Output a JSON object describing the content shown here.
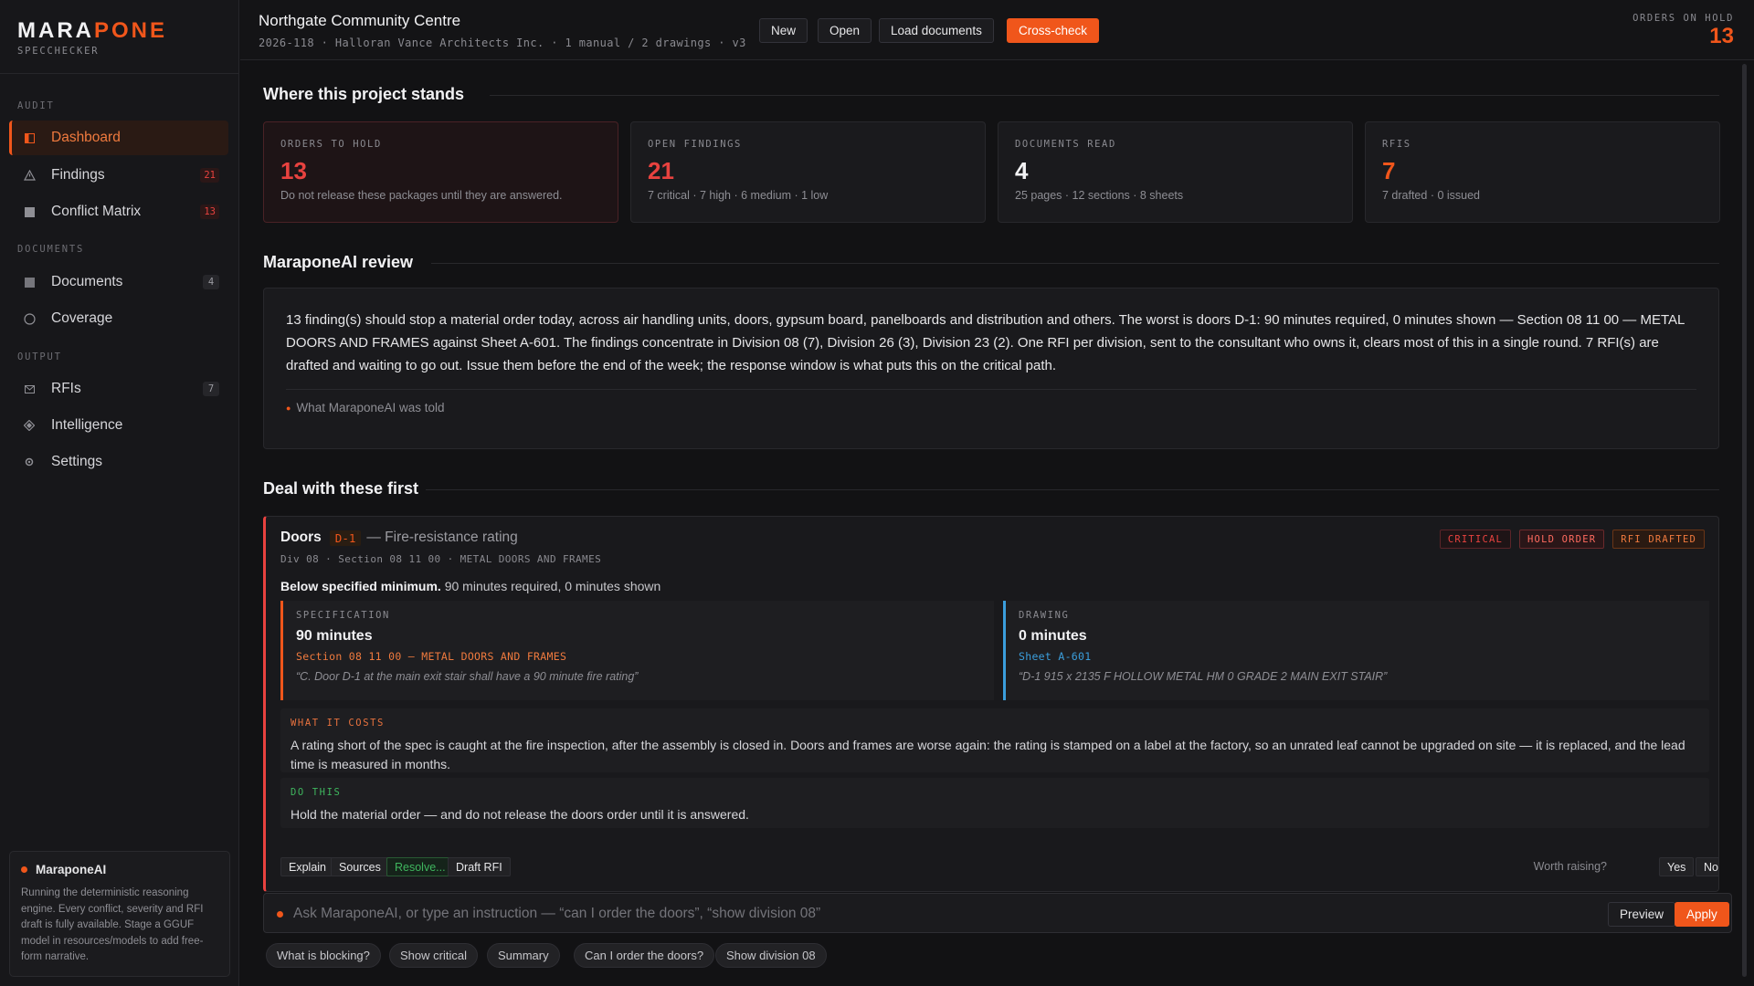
{
  "brand": {
    "name_a": "MARA",
    "name_b": "PONE",
    "subtitle": "SPECCHECKER"
  },
  "sidebar": {
    "sections": {
      "audit": "AUDIT",
      "documents": "DOCUMENTS",
      "output": "OUTPUT"
    },
    "items": [
      {
        "label": "Dashboard",
        "icon": "dashboard-icon"
      },
      {
        "label": "Findings",
        "badge": "21",
        "icon": "warning-icon"
      },
      {
        "label": "Conflict Matrix",
        "badge": "13",
        "icon": "matrix-icon"
      },
      {
        "label": "Documents",
        "badge": "4",
        "icon": "document-icon"
      },
      {
        "label": "Coverage",
        "icon": "coverage-icon"
      },
      {
        "label": "RFIs",
        "badge": "7",
        "icon": "mail-icon"
      },
      {
        "label": "Intelligence",
        "icon": "diamond-icon"
      },
      {
        "label": "Settings",
        "icon": "gear-icon"
      }
    ],
    "ai_box": {
      "title": "MaraponeAI",
      "desc": "Running the deterministic reasoning engine. Every conflict, severity and RFI draft is fully available. Stage a GGUF model in resources/models to add free-form narrative."
    }
  },
  "topbar": {
    "title": "Northgate Community Centre",
    "meta": "2026-118 · Halloran Vance Architects Inc. · 1 manual / 2 drawings · v3",
    "buttons": {
      "new": "New",
      "open": "Open",
      "load": "Load documents",
      "cross": "Cross-check"
    },
    "hold_label": "ORDERS ON HOLD",
    "hold_value": "13"
  },
  "stands": {
    "heading": "Where this project stands",
    "stats": [
      {
        "label": "ORDERS TO HOLD",
        "value": "13",
        "sub": "Do not release these packages until they are answered."
      },
      {
        "label": "OPEN FINDINGS",
        "value": "21",
        "sub": "7 critical · 7 high · 6 medium · 1 low"
      },
      {
        "label": "DOCUMENTS READ",
        "value": "4",
        "sub": "25 pages · 12 sections · 8 sheets"
      },
      {
        "label": "RFIS",
        "value": "7",
        "sub": "7 drafted · 0 issued"
      }
    ]
  },
  "review": {
    "heading": "MaraponeAI review",
    "text": "13 finding(s) should stop a material order today, across air handling units, doors, gypsum board, panelboards and distribution and others. The worst is doors D-1: 90 minutes required, 0 minutes shown — Section 08 11 00 — METAL DOORS AND FRAMES against Sheet A-601. The findings concentrate in Division 08 (7), Division 26 (3), Division 23 (2). One RFI per division, sent to the consultant who owns it, clears most of this in a single round. 7 RFI(s) are drafted and waiting to go out. Issue them before the end of the week; the response window is what puts this on the critical path.",
    "told": "What MaraponeAI was told"
  },
  "first": {
    "heading": "Deal with these first",
    "finding": {
      "name": "Doors",
      "tag": "D-1",
      "title": "— Fire-resistance rating",
      "sub": "Div 08 · Section 08 11 00 · METAL DOORS AND FRAMES",
      "badges": {
        "critical": "CRITICAL",
        "hold": "HOLD ORDER",
        "rfi": "RFI DRAFTED"
      },
      "summary_bold": "Below specified minimum.",
      "summary_rest": " 90 minutes required, 0 minutes shown",
      "spec": {
        "label": "SPECIFICATION",
        "value": "90 minutes",
        "ref": "Section 08 11 00 — METAL DOORS AND FRAMES",
        "quote": "“C. Door D-1 at the main exit stair shall have a 90 minute fire rating”"
      },
      "drawing": {
        "label": "DRAWING",
        "value": "0 minutes",
        "ref": "Sheet A-601",
        "quote": "“D-1 915 x 2135 F HOLLOW METAL HM 0 GRADE 2 MAIN EXIT STAIR”"
      },
      "cost": {
        "label": "WHAT IT COSTS",
        "text": "A rating short of the spec is caught at the fire inspection, after the assembly is closed in. Doors and frames are worse again: the rating is stamped on a label at the factory, so an unrated leaf cannot be upgraded on site — it is replaced, and the lead time is measured in months."
      },
      "do": {
        "label": "DO THIS",
        "text": "Hold the material order — and do not release the doors order until it is answered."
      },
      "actions": {
        "explain": "Explain",
        "sources": "Sources",
        "resolve": "Resolve...",
        "draft": "Draft RFI"
      },
      "worth": {
        "label": "Worth raising?",
        "yes": "Yes",
        "no": "No"
      }
    }
  },
  "command": {
    "placeholder": "Ask MaraponeAI, or type an instruction — “can I order the doors”, “show division 08”",
    "preview": "Preview",
    "apply": "Apply",
    "chips": [
      "What is blocking?",
      "Show critical",
      "Summary",
      "Can I order the doors?",
      "Show division 08"
    ]
  },
  "colors": {
    "accent": "#f0561b",
    "critical": "#e8423f",
    "success": "#3fb65e",
    "drawing": "#3b9edc"
  }
}
